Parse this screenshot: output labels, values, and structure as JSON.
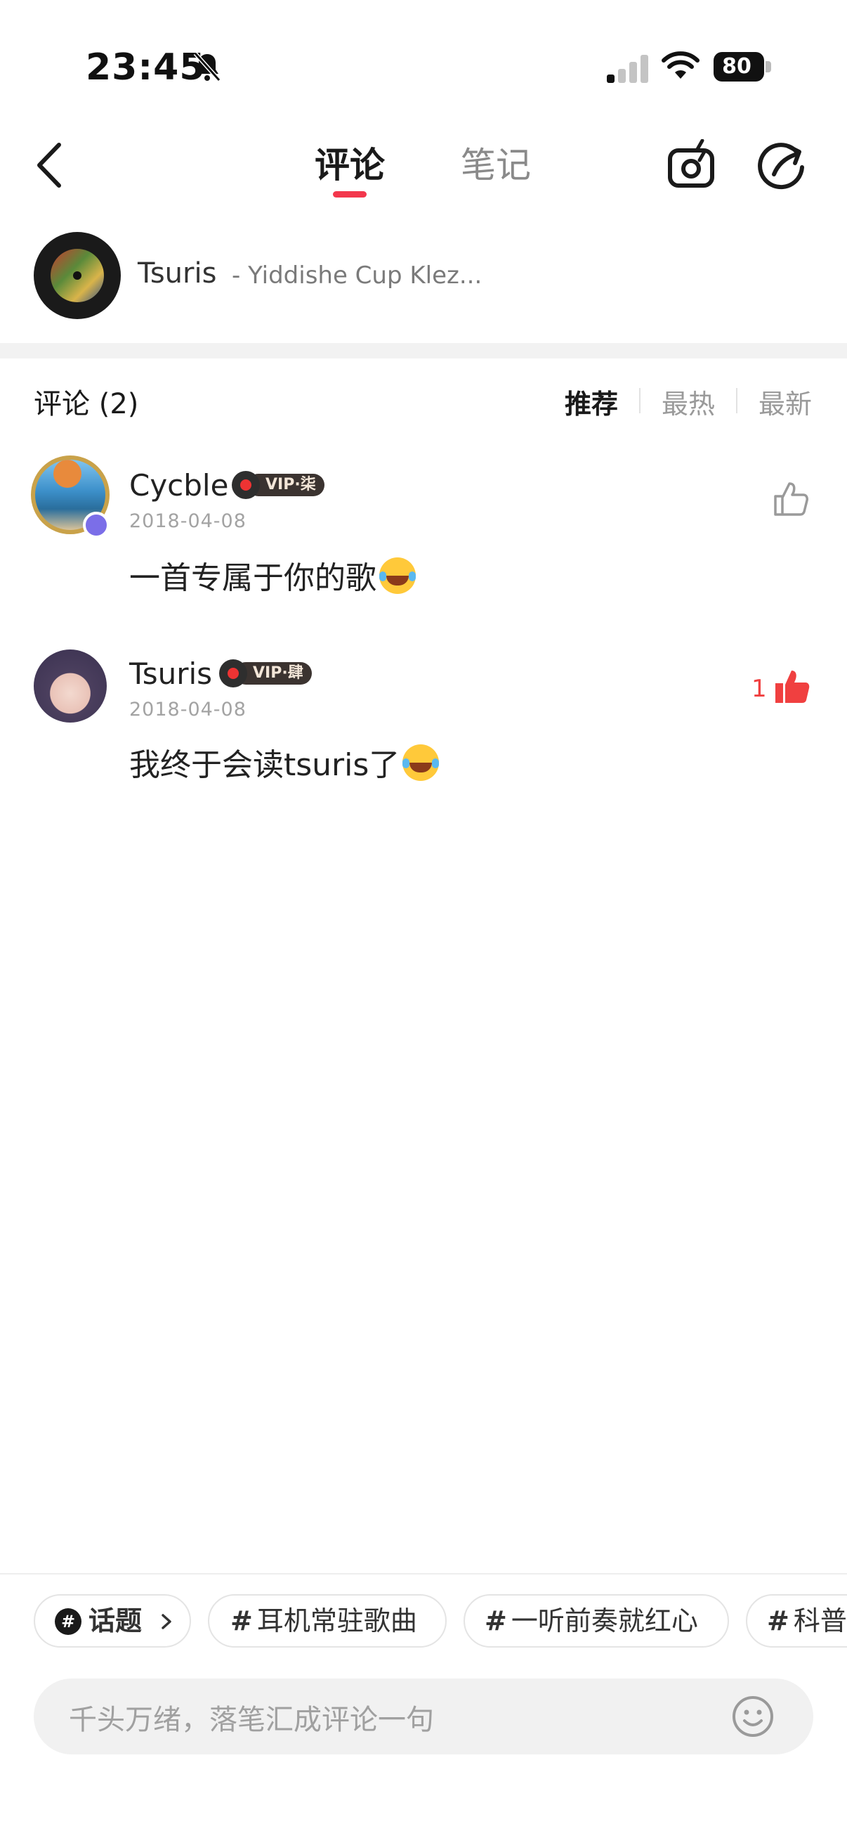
{
  "status_bar": {
    "time": "23:45",
    "battery": "80"
  },
  "header": {
    "tabs": [
      {
        "label": "评论",
        "active": true
      },
      {
        "label": "笔记",
        "active": false
      }
    ]
  },
  "song": {
    "title": "Tsuris",
    "artist": "- Yiddishe Cup Klez..."
  },
  "comments_section": {
    "count_label": "评论 (2)",
    "sort_options": [
      "推荐",
      "最热",
      "最新"
    ],
    "active_sort": "推荐"
  },
  "comments": [
    {
      "username": "Cycble",
      "vip_label": "VIP·柒",
      "date": "2018-04-08",
      "text": "一首专属于你的歌",
      "likes": "",
      "liked": false
    },
    {
      "username": "Tsuris",
      "vip_label": "VIP·肆",
      "date": "2018-04-08",
      "text": "我终于会读tsuris了",
      "likes": "1",
      "liked": true
    }
  ],
  "topics": {
    "topic_button": "话题",
    "chips": [
      "耳机常驻歌曲",
      "一听前奏就红心",
      "科普"
    ]
  },
  "input": {
    "placeholder": "千头万绪，落笔汇成评论一句"
  },
  "colors": {
    "accent": "#f3374c",
    "like_active": "#f04040",
    "muted": "#9a9a9a"
  }
}
